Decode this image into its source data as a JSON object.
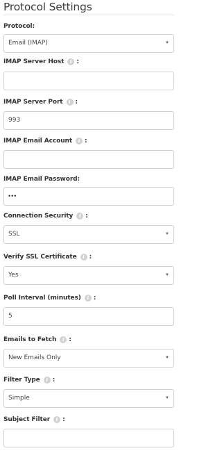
{
  "header": {
    "title": "Protocol Settings"
  },
  "fields": {
    "protocol": {
      "label": "Protocol:",
      "value": "Email (IMAP)"
    },
    "imap_host": {
      "label": "IMAP Server Host",
      "colon": ":",
      "value": ""
    },
    "imap_port": {
      "label": "IMAP Server Port",
      "colon": ":",
      "value": "993"
    },
    "imap_account": {
      "label": "IMAP Email Account",
      "colon": ":",
      "value": ""
    },
    "imap_password": {
      "label": "IMAP Email Password:",
      "value": "•••"
    },
    "connection_security": {
      "label": "Connection Security",
      "colon": ":",
      "value": "SSL"
    },
    "verify_ssl": {
      "label": "Verify SSL Certificate",
      "colon": ":",
      "value": "Yes"
    },
    "poll_interval": {
      "label": "Poll Interval (minutes)",
      "colon": ":",
      "value": "5"
    },
    "emails_to_fetch": {
      "label": "Emails to Fetch",
      "colon": ":",
      "value": "New Emails Only"
    },
    "filter_type": {
      "label": "Filter Type",
      "colon": ":",
      "value": "Simple"
    },
    "subject_filter": {
      "label": "Subject Filter",
      "colon": ":",
      "value": ""
    }
  },
  "icons": {
    "info": "info-icon",
    "dropdown": "caret-down-icon"
  },
  "colors": {
    "border": "#cfcfcf",
    "info_badge": "#d2d2d2",
    "rule": "#e6e6e6"
  }
}
